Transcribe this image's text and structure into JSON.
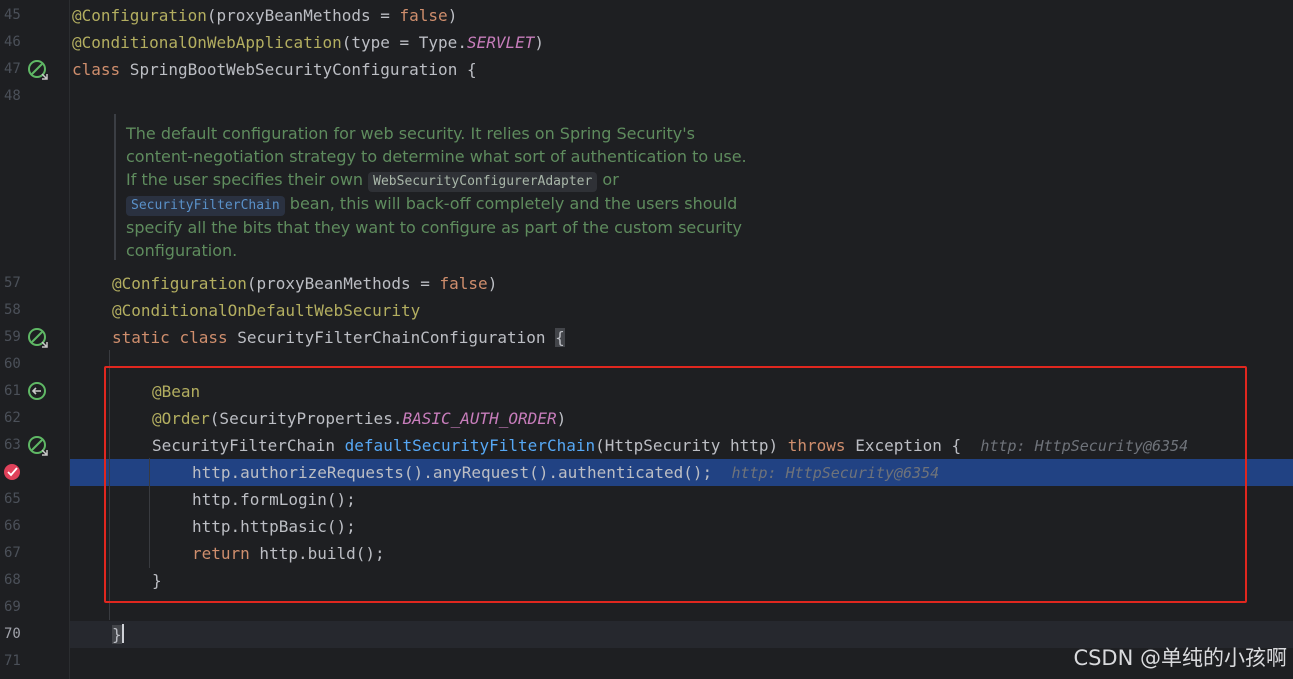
{
  "line_numbers": [
    "45",
    "46",
    "47",
    "48",
    "57",
    "58",
    "59",
    "60",
    "61",
    "62",
    "63",
    "",
    "65",
    "66",
    "67",
    "68",
    "69",
    "70",
    "71"
  ],
  "current_line": "70",
  "gutter_icons": {
    "line47": "bean-class-icon",
    "line59": "bean-class-icon",
    "line61": "bean-method-arrow-icon",
    "line63": "bean-method-icon",
    "breakpoint": "breakpoint-icon"
  },
  "code": {
    "l45": {
      "ann": "@Configuration",
      "rest": "(proxyBeanMethods = ",
      "kw": "false",
      "end": ")"
    },
    "l46": {
      "ann": "@ConditionalOnWebApplication",
      "rest": "(type = Type.",
      "const": "SERVLET",
      "end": ")"
    },
    "l47": {
      "kw": "class",
      "rest": " SpringBootWebSecurityConfiguration {"
    },
    "l57": {
      "ann": "@Configuration",
      "rest": "(proxyBeanMethods = ",
      "kw": "false",
      "end": ")"
    },
    "l58": {
      "ann": "@ConditionalOnDefaultWebSecurity"
    },
    "l59": {
      "kw1": "static",
      "kw2": "class",
      "rest": " SecurityFilterChainConfiguration ",
      "brace": "{"
    },
    "l61": {
      "ann": "@Bean"
    },
    "l62": {
      "ann": "@Order",
      "rest": "(SecurityProperties.",
      "const": "BASIC_AUTH_ORDER",
      "end": ")"
    },
    "l63": {
      "type": "SecurityFilterChain ",
      "fn": "defaultSecurityFilterChain",
      "params": "(HttpSecurity http) ",
      "kw": "throws",
      "rest": " Exception {",
      "hint": "http: HttpSecurity@6354"
    },
    "l64": {
      "text": "http.authorizeRequests().anyRequest().authenticated();",
      "hint": "http: HttpSecurity@6354"
    },
    "l65": {
      "text": "http.formLogin();"
    },
    "l66": {
      "text": "http.httpBasic();"
    },
    "l67": {
      "kw": "return",
      "rest": " http.build();"
    },
    "l68": {
      "text": "}"
    },
    "l70": {
      "text": "}"
    }
  },
  "doc": {
    "p1": "The default configuration for web security. It relies on Spring Security's content-negotiation strategy to determine what sort of authentication to use. If the user specifies their own ",
    "chip1": "WebSecurityConfigurerAdapter",
    "p2": " or ",
    "chip2": "SecurityFilterChain",
    "p3": " bean, this will back-off completely and the users should specify all the bits that they want to configure as part of the custom security configuration."
  },
  "watermark": "CSDN @单纯的小孩啊",
  "colors": {
    "background": "#1e1f22",
    "annotation": "#b3ae60",
    "keyword": "#cf8e6d",
    "constant": "#c77dbb",
    "method": "#56a8f5",
    "execution_line": "#214283",
    "highlight_box": "#e0271f"
  }
}
